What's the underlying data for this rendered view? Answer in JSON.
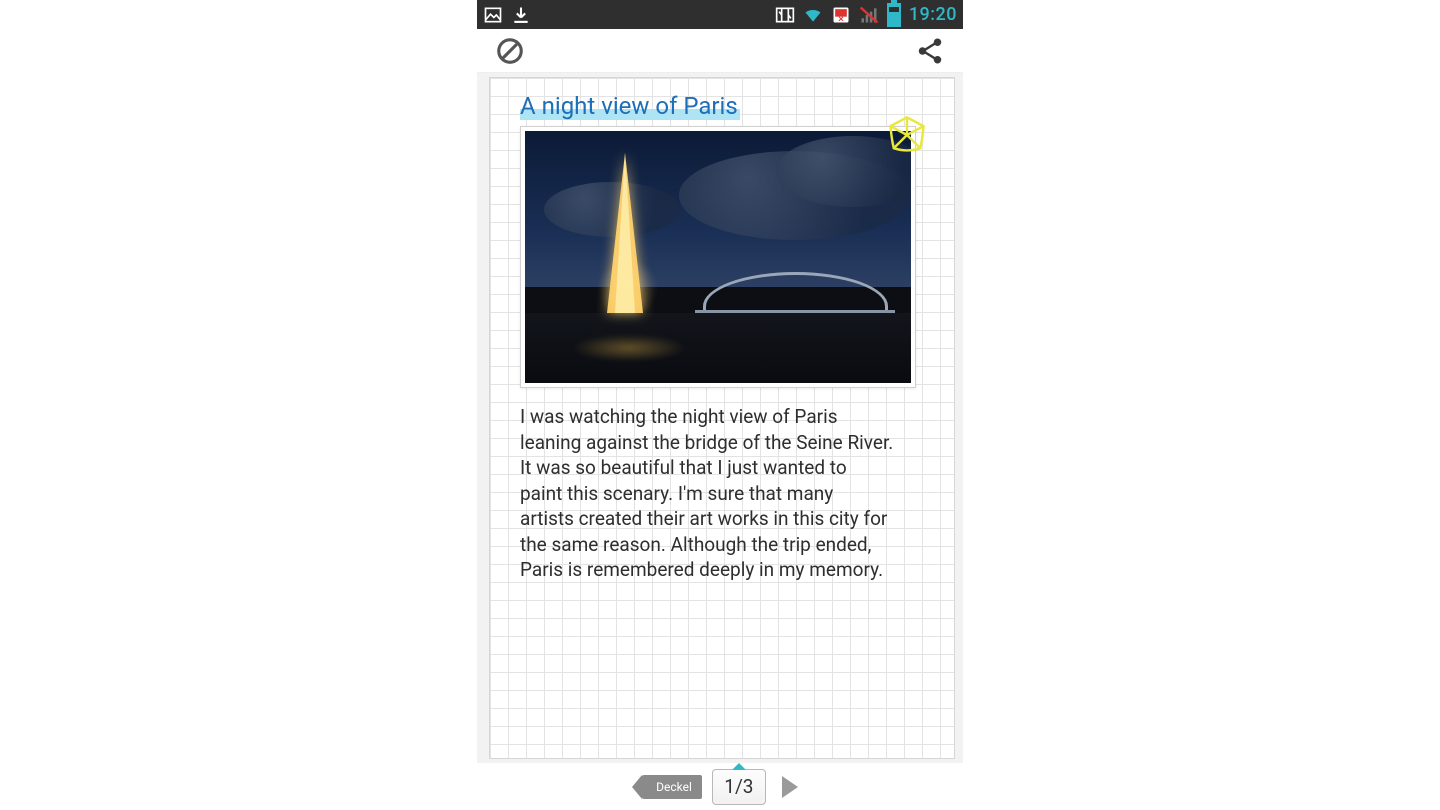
{
  "statusbar": {
    "time": "19:20",
    "icons": [
      "picture-icon",
      "download-icon",
      "sync-icon",
      "wifi-icon",
      "data-off-icon",
      "no-signal-icon",
      "battery-icon"
    ]
  },
  "toolbar": {
    "left_icon": "prohibit-icon",
    "right_icon": "share-icon"
  },
  "note": {
    "title": "A night view of Paris",
    "body": "I was watching the night view of Paris\nleaning against the bridge of the Seine River.\nIt was so beautiful that I just wanted to\npaint this scenary. I'm sure that many\nartists created their art works in this city for\nthe same reason. Although the trip ended,\nParis is remembered deeply in my memory.",
    "sticker": "flower-sticker",
    "photo_subject": "Eiffel Tower at night over the Seine with a lit arch bridge"
  },
  "pager": {
    "deck_label": "Deckel",
    "page_label": "1/3",
    "current": 1,
    "total": 3
  }
}
